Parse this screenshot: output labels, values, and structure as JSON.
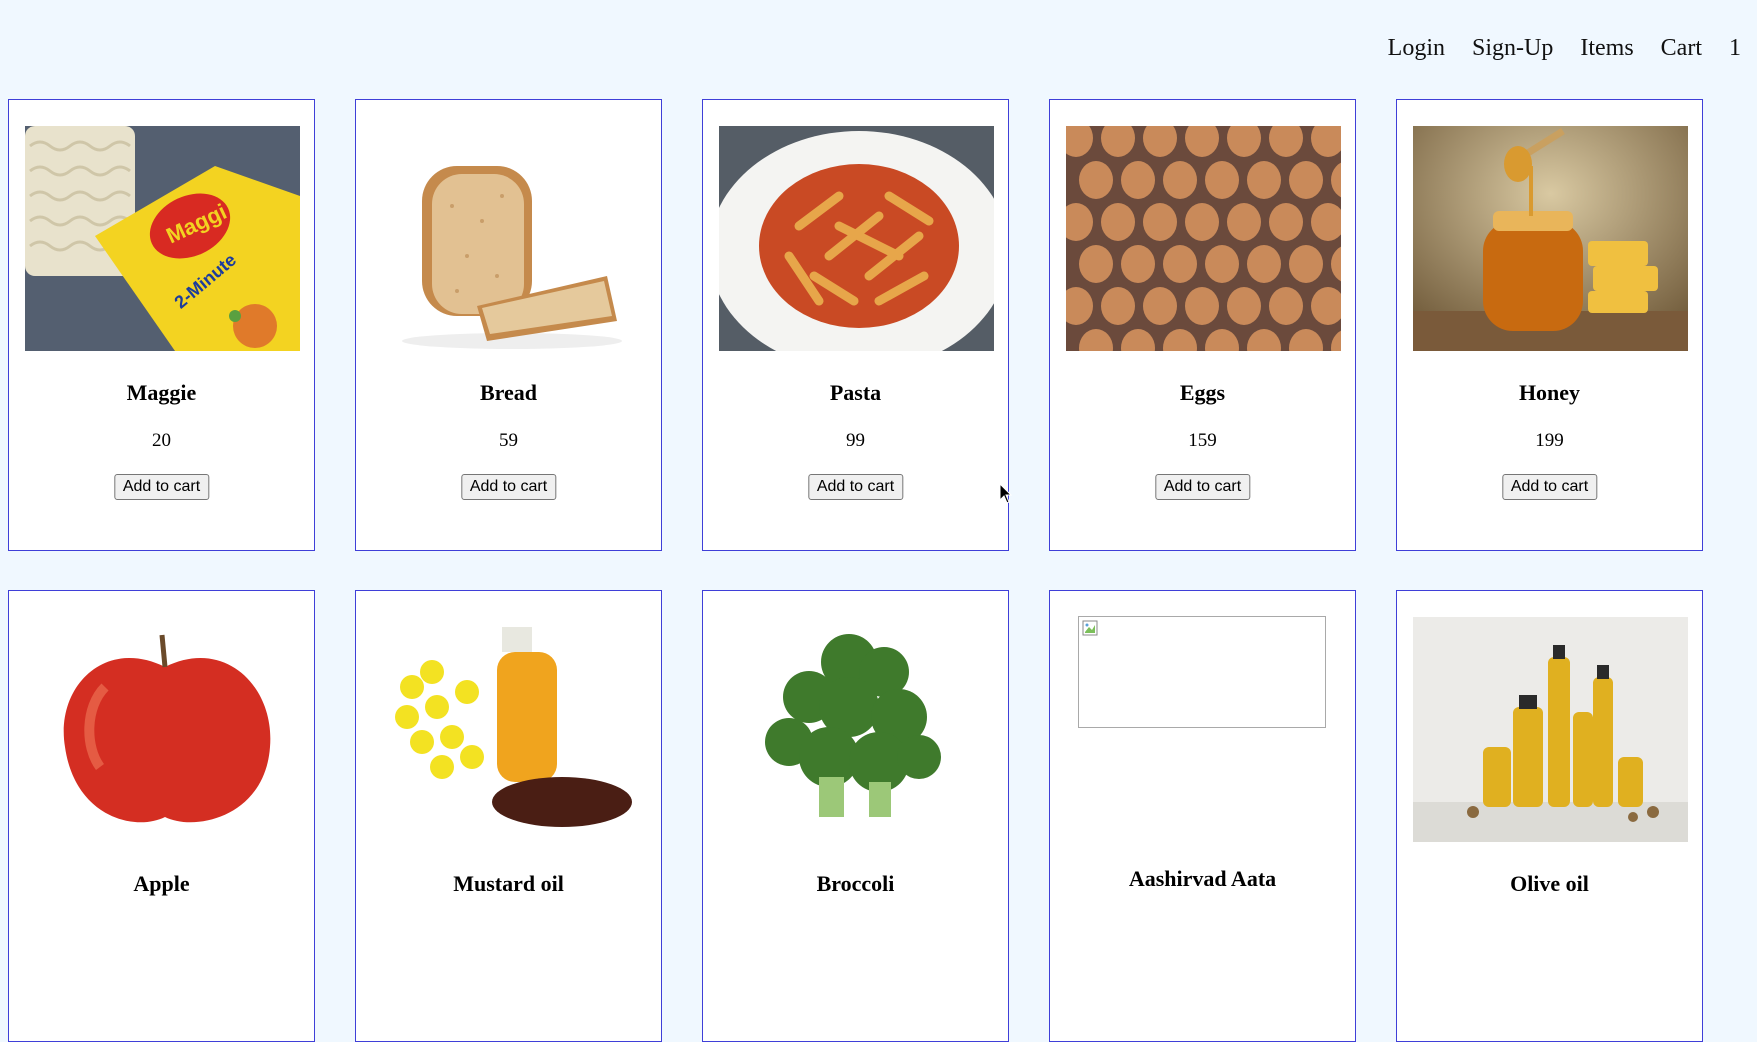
{
  "nav": {
    "login": "Login",
    "signup": "Sign-Up",
    "items": "Items",
    "cart": "Cart",
    "cart_count": "1"
  },
  "button_label": "Add to cart",
  "products": [
    {
      "name": "Maggie",
      "price": "20",
      "image": "maggi-noodles-image"
    },
    {
      "name": "Bread",
      "price": "59",
      "image": "bread-image"
    },
    {
      "name": "Pasta",
      "price": "99",
      "image": "pasta-image"
    },
    {
      "name": "Eggs",
      "price": "159",
      "image": "eggs-image"
    },
    {
      "name": "Honey",
      "price": "199",
      "image": "honey-image"
    },
    {
      "name": "Apple",
      "image": "apple-image"
    },
    {
      "name": "Mustard oil",
      "image": "mustard-oil-image"
    },
    {
      "name": "Broccoli",
      "image": "broccoli-image"
    },
    {
      "name": "Aashirvad Aata",
      "image": "broken-image-icon"
    },
    {
      "name": "Olive oil",
      "image": "olive-oil-image"
    }
  ],
  "colors": {
    "page_bg": "#f0f8ff",
    "card_border": "#3f3fd8",
    "card_bg": "#ffffff"
  }
}
